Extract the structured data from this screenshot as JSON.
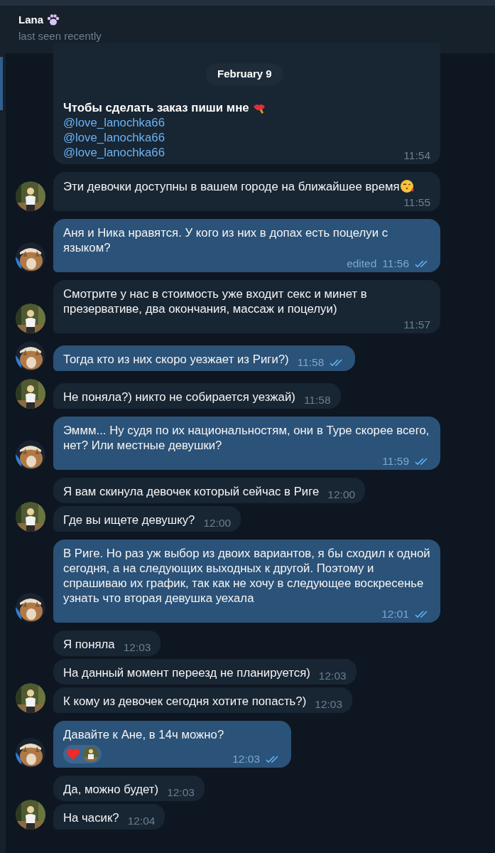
{
  "header": {
    "name": "Lana",
    "status": "last seen recently"
  },
  "date_chip": "February 9",
  "groups": [
    {
      "kind": "in",
      "messages": [
        {
          "lines": [
            {
              "kind": "bold",
              "text": "Чтобы сделать заказ пиши мне",
              "icon": true
            },
            {
              "kind": "mention",
              "text": "@love_lanochka66"
            },
            {
              "kind": "mention",
              "text": "@love_lanochka66"
            },
            {
              "kind": "mention",
              "text": "@love_lanochka66"
            }
          ],
          "time": "11:54",
          "continued_above": true
        }
      ]
    },
    {
      "kind": "in",
      "messages": [
        {
          "lines": [
            {
              "kind": "plain",
              "text": "Эти девочки доступны в вашем городе на ближайшее время",
              "icon": true
            }
          ],
          "time": "11:55"
        }
      ]
    },
    {
      "kind": "out",
      "messages": [
        {
          "lines": [
            {
              "kind": "plain",
              "text": "Аня и Ника нравятся. У кого из них в допах есть поцелуи с языком?"
            }
          ],
          "edited": "edited",
          "time": "11:56",
          "read": true
        }
      ]
    },
    {
      "kind": "in",
      "messages": [
        {
          "lines": [
            {
              "kind": "plain",
              "text": "Смотрите у нас в стоимость уже входит секс и минет в презервативе, два окончания, массаж и поцелуи)"
            }
          ],
          "time": "11:57"
        }
      ]
    },
    {
      "kind": "out",
      "messages": [
        {
          "lines": [
            {
              "kind": "plain",
              "text": "Тогда кто из них скоро уезжает из Риги?)"
            }
          ],
          "time": "11:58",
          "read": true
        }
      ]
    },
    {
      "kind": "in",
      "messages": [
        {
          "lines": [
            {
              "kind": "plain",
              "text": "Не поняла?) никто не собирается уезжай)"
            }
          ],
          "time": "11:58"
        }
      ]
    },
    {
      "kind": "out",
      "messages": [
        {
          "lines": [
            {
              "kind": "plain",
              "text": "Эммм... Ну судя по их национальностям, они в Туре скорее всего, нет? Или местные девушки?"
            }
          ],
          "time": "11:59",
          "read": true
        }
      ]
    },
    {
      "kind": "in",
      "messages": [
        {
          "lines": [
            {
              "kind": "plain",
              "text": "Я вам скинула девочек который сейчас в Риге"
            }
          ],
          "time": "12:00"
        },
        {
          "lines": [
            {
              "kind": "plain",
              "text": "Где вы ищете девушку?"
            }
          ],
          "time": "12:00"
        }
      ]
    },
    {
      "kind": "out",
      "messages": [
        {
          "lines": [
            {
              "kind": "plain",
              "text": "В Риге. Но раз уж выбор из двоих вариантов, я бы сходил к одной сегодня, а на следующих выходных к другой. Поэтому и спрашиваю их график, так как не хочу в следующее воскресенье узнать что вторая девушка уехала"
            }
          ],
          "time": "12:01",
          "read": true
        }
      ]
    },
    {
      "kind": "in",
      "messages": [
        {
          "lines": [
            {
              "kind": "plain",
              "text": "Я поняла"
            }
          ],
          "time": "12:03"
        },
        {
          "lines": [
            {
              "kind": "plain",
              "text": "На данный момент переезд не планируется)"
            }
          ],
          "time": "12:03"
        },
        {
          "lines": [
            {
              "kind": "plain",
              "text": "К кому из девочек сегодня хотите попасть?)"
            }
          ],
          "time": "12:03"
        }
      ]
    },
    {
      "kind": "out",
      "messages": [
        {
          "lines": [
            {
              "kind": "plain",
              "text": "Давайте к Ане, в 14ч можно?"
            }
          ],
          "time": "12:03",
          "read": true,
          "reaction": true
        }
      ]
    },
    {
      "kind": "in",
      "messages": [
        {
          "lines": [
            {
              "kind": "plain",
              "text": "Да, можно будет)"
            }
          ],
          "time": "12:03"
        },
        {
          "lines": [
            {
              "kind": "plain",
              "text": "На часик?"
            }
          ],
          "time": "12:04"
        }
      ]
    }
  ]
}
